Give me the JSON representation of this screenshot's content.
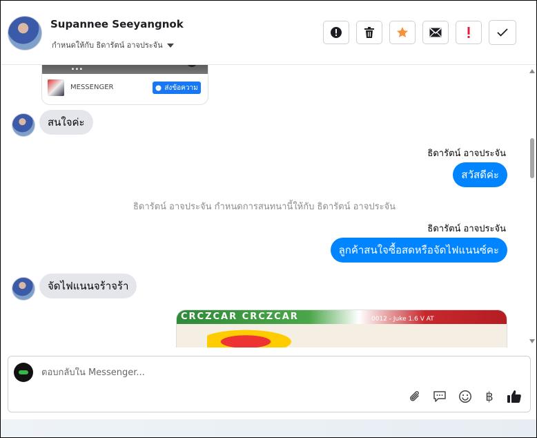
{
  "header": {
    "contact_name": "Supannee Seeyangnok",
    "assigned_to": "กำหนดให้กับ ธิดารัตน์ อาจประจัน",
    "toolbar": [
      {
        "name": "spam-button",
        "icon": "alert-circle-icon"
      },
      {
        "name": "delete-button",
        "icon": "trash-icon"
      },
      {
        "name": "star-button",
        "icon": "star-icon"
      },
      {
        "name": "mark-unread-button",
        "icon": "envelope-icon"
      },
      {
        "name": "follow-up-button",
        "icon": "exclamation-icon"
      },
      {
        "name": "mark-done-button",
        "icon": "check-icon"
      }
    ],
    "star_color": "#f7923b",
    "alert_color": "#e41e3f"
  },
  "conversation": {
    "card": {
      "image_text": "...",
      "label": "MESSENGER",
      "button": "ส่งข้อความ"
    },
    "messages": [
      {
        "from": "customer",
        "text": "สนใจค่ะ"
      },
      {
        "from": "page",
        "sender": "ธิดารัตน์ อาจประจัน",
        "text": "สวัสดีค่ะ"
      },
      {
        "from": "system",
        "text": "ธิดารัตน์ อาจประจัน กำหนดการสนทนานี้ให้กับ ธิดารัตน์ อาจประจัน"
      },
      {
        "from": "page",
        "sender": "ธิดารัตน์ อาจประจัน",
        "text": "ลูกค้าสนใจซื้อสดหรือจัดไฟแนนซ์คะ"
      },
      {
        "from": "customer",
        "text": "จัดไฟแนนจร้าจร้า"
      }
    ],
    "banner": {
      "top_text": "CRCZCAR CRCZCAR",
      "model_text": "0012 - Juke 1.6 V AT"
    },
    "bubble_color": "#0084ff"
  },
  "composer": {
    "placeholder": "ตอบกลับใน Messenger...",
    "icons": [
      "paperclip-icon",
      "chat-bubble-icon",
      "emoji-icon",
      "baht-icon",
      "thumbs-up-icon"
    ],
    "baht_symbol": "฿"
  }
}
